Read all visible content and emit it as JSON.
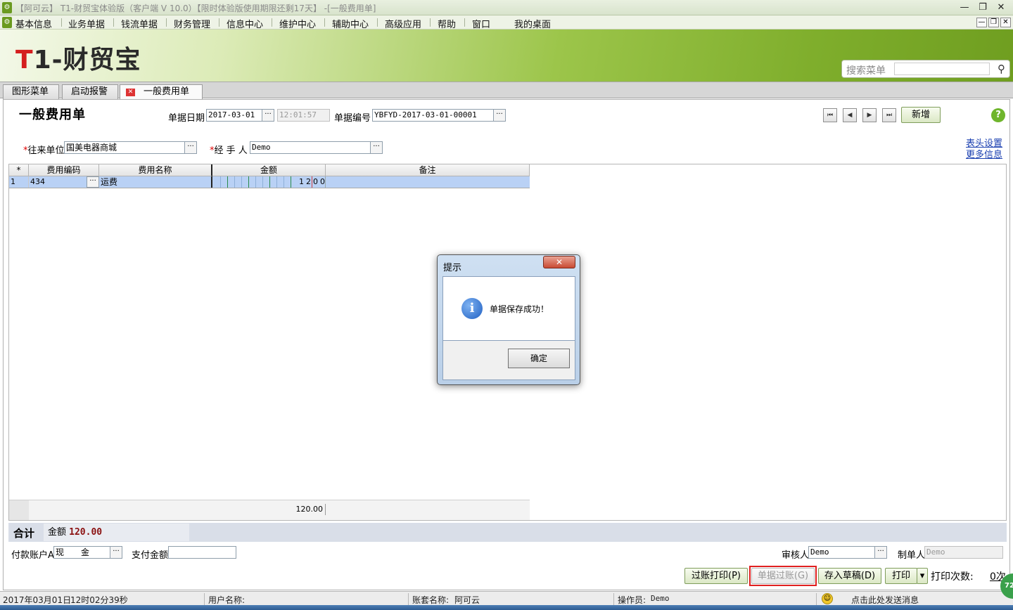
{
  "window": {
    "title": "【阿可云】 T1-财贸宝体验版（客户端 V 10.0）【限时体验版使用期限还剩17天】 -[一般费用单]",
    "app_icon": "lock-icon",
    "minimize": "—",
    "restore": "❐",
    "close": "✕"
  },
  "menu": {
    "items": [
      "基本信息",
      "业务单据",
      "钱流单据",
      "财务管理",
      "信息中心",
      "维护中心",
      "辅助中心",
      "高级应用",
      "帮助",
      "窗口",
      "我的桌面"
    ],
    "mdi_minimize": "—",
    "mdi_restore": "❐",
    "mdi_close": "✕"
  },
  "banner": {
    "logo_t": "T",
    "logo_rest": "1-财贸宝",
    "search_label": "搜索菜单",
    "search_value": "",
    "search_icon": "search-icon"
  },
  "tabs": [
    {
      "label": "图形菜单"
    },
    {
      "label": "启动报警"
    },
    {
      "label": "一般费用单",
      "close": "✕"
    }
  ],
  "form": {
    "title": "一般费用单",
    "date_label": "单据日期",
    "date_value": "2017-03-01",
    "time_value": "12:01:57",
    "number_label": "单据编号",
    "number_value": "YBFYD-2017-03-01-00001",
    "ellipsis": "···",
    "nav": {
      "first": "⏮",
      "prev": "◀",
      "next": "▶",
      "last": "⏭"
    },
    "add_button": "新增",
    "help": "?",
    "party_required": "*",
    "party_label": "往来单位",
    "party_value": "国美电器商城",
    "handler_required": "*",
    "handler_label": "经 手 人",
    "handler_value": "Demo",
    "link_header_settings": "表头设置",
    "link_more_info": "更多信息"
  },
  "grid": {
    "columns": [
      "*",
      "费用编码",
      "费用名称",
      "金额",
      "备注"
    ],
    "rows": [
      {
        "no": "1",
        "code": "434",
        "name": "运费",
        "amount": "12000",
        "note": ""
      }
    ],
    "amount_total": "120.00"
  },
  "totals": {
    "label": "合计",
    "amount_label": "金额",
    "amount_value": "120.00"
  },
  "payment": {
    "account_label": "付款账户A",
    "account_value": "现　　金",
    "pay_amount_label": "支付金额",
    "pay_amount_value": "",
    "reviewer_label": "审核人",
    "reviewer_value": "Demo",
    "maker_label": "制单人",
    "maker_value": "Demo"
  },
  "actions": {
    "post_print": "过账打印(P)",
    "post": "单据过账(G)",
    "save_draft": "存入草稿(D)",
    "print": "打印",
    "print_dropdown": "▾",
    "print_count_label": "打印次数:",
    "print_count_value": "0次"
  },
  "dialog": {
    "title": "提示",
    "close": "✕",
    "icon": "info-icon",
    "icon_glyph": "i",
    "message": "单据保存成功！",
    "ok": "确定"
  },
  "status": {
    "date": "2017年03月01日",
    "time": "12时02分39秒",
    "user_label": "用户名称:",
    "user_value": "",
    "account_set_label": "账套名称:",
    "account_set_value": "阿可云",
    "operator_label": "操作员:",
    "operator_value": "Demo",
    "smile": "☺",
    "message_link": "点击此处发送消息",
    "badge": "72"
  }
}
